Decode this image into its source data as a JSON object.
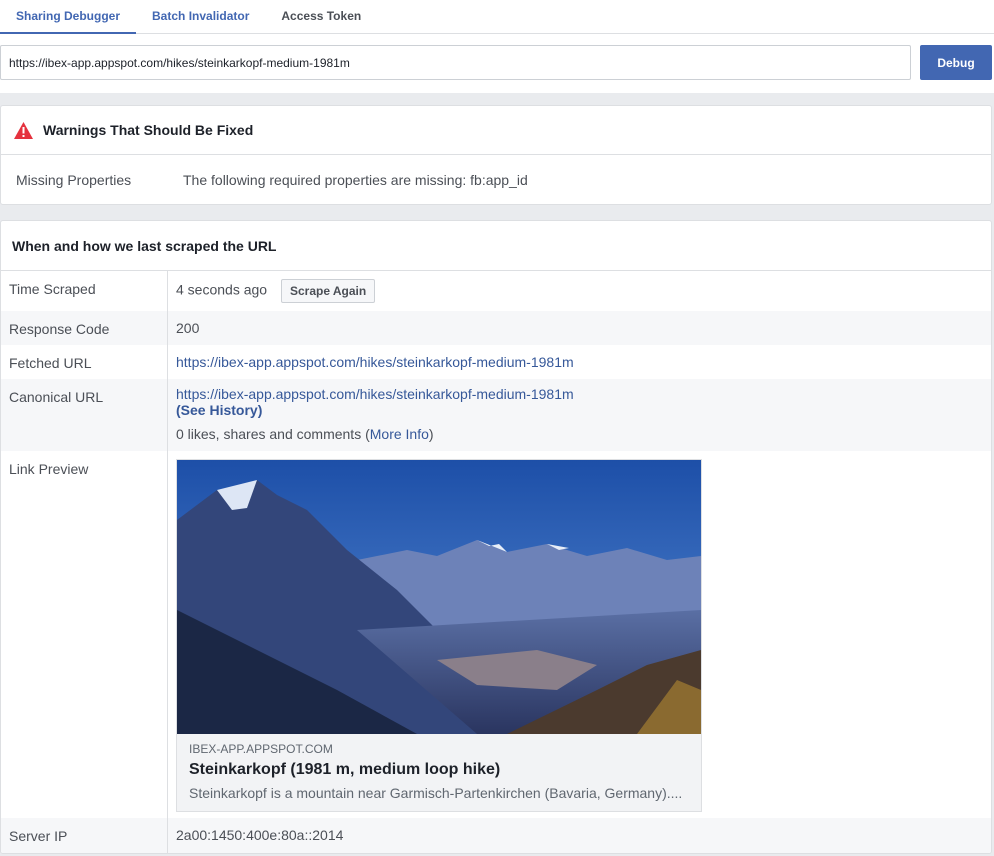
{
  "tabs": [
    {
      "label": "Sharing Debugger"
    },
    {
      "label": "Batch Invalidator"
    },
    {
      "label": "Access Token"
    }
  ],
  "url_input": {
    "value": "https://ibex-app.appspot.com/hikes/steinkarkopf-medium-1981m"
  },
  "debug_button": "Debug",
  "warnings": {
    "title": "Warnings That Should Be Fixed",
    "label": "Missing Properties",
    "message": "The following required properties are missing: fb:app_id",
    "icon": "warning-triangle-icon",
    "icon_color": "#e5323e"
  },
  "scrape": {
    "title": "When and how we last scraped the URL",
    "rows": {
      "time_label": "Time Scraped",
      "time_value": "4 seconds ago",
      "scrape_again": "Scrape Again",
      "response_label": "Response Code",
      "response_value": "200",
      "fetched_label": "Fetched URL",
      "fetched_value": "https://ibex-app.appspot.com/hikes/steinkarkopf-medium-1981m",
      "canonical_label": "Canonical URL",
      "canonical_value": "https://ibex-app.appspot.com/hikes/steinkarkopf-medium-1981m",
      "see_history": "(See History)",
      "likes_text": "0 likes, shares and comments (",
      "more_info": "More Info",
      "likes_close": ")",
      "preview_label": "Link Preview",
      "server_label": "Server IP",
      "server_value": "2a00:1450:400e:80a::2014"
    }
  },
  "preview": {
    "domain": "IBEX-APP.APPSPOT.COM",
    "title": "Steinkarkopf (1981 m, medium loop hike)",
    "description": "Steinkarkopf is a mountain near Garmisch-Partenkirchen (Bavaria, Germany)...."
  },
  "colors": {
    "accent": "#4267b2",
    "link": "#365899"
  }
}
